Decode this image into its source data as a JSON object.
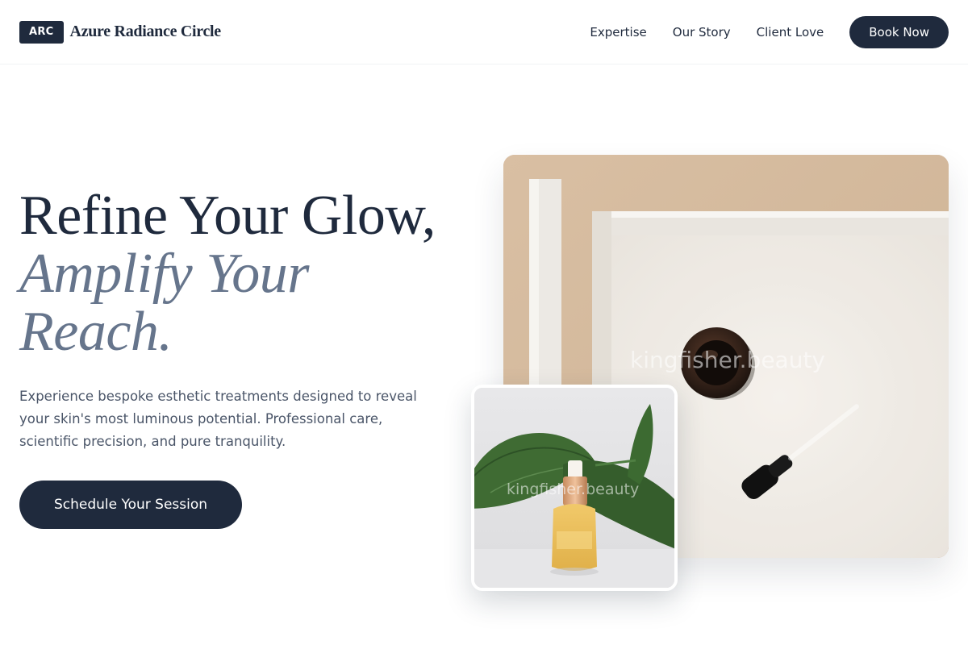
{
  "header": {
    "logo_badge": "ARC",
    "brand_name": "Azure Radiance Circle",
    "nav": [
      {
        "label": "Expertise"
      },
      {
        "label": "Our Story"
      },
      {
        "label": "Client Love"
      }
    ],
    "cta_label": "Book Now"
  },
  "hero": {
    "headline_line1": "Refine Your Glow,",
    "headline_line2": "Amplify Your Reach.",
    "subcopy": "Experience bespoke esthetic treatments designed to reveal your skin's most luminous potential. Professional care, scientific precision, and pure tranquility.",
    "cta_label": "Schedule Your Session"
  },
  "images": {
    "main": {
      "watermark": "kingfisher.beauty"
    },
    "inset": {
      "watermark": "kingfisher.beauty"
    }
  },
  "colors": {
    "primary": "#1f2a3d",
    "accent_italic": "#66758c",
    "body_text": "#4a5568",
    "background": "#ffffff"
  }
}
